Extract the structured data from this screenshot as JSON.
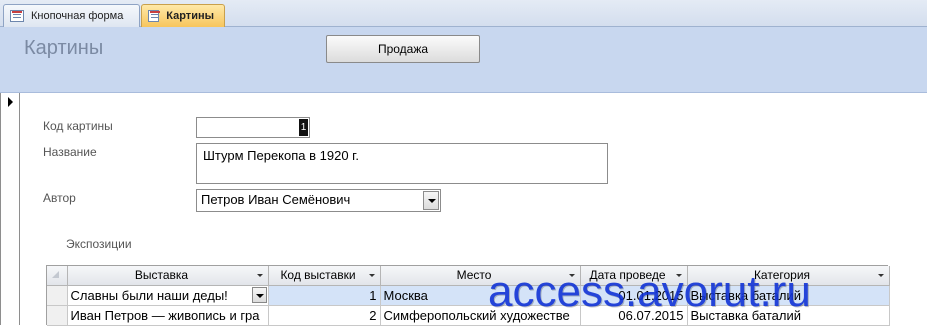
{
  "tabs": [
    {
      "label": "Кнопочная форма",
      "active": false
    },
    {
      "label": "Картины",
      "active": true
    }
  ],
  "header": {
    "title": "Картины",
    "sale_button": "Продажа"
  },
  "fields": {
    "code_label": "Код картины",
    "code_value": "1",
    "name_label": "Название",
    "name_value": "Штурм Перекопа в 1920 г.",
    "author_label": "Автор",
    "author_value": "Петров Иван Семёнович"
  },
  "subform": {
    "label": "Экспозиции",
    "columns": [
      "Выставка",
      "Код выставки",
      "Место",
      "Дата проведе",
      "Категория"
    ],
    "rows": [
      [
        "Славны были наши деды!",
        "1",
        "Москва",
        "01.01.2015",
        "Выставка баталий"
      ],
      [
        "Иван Петров — живопись и гра",
        "2",
        "Симферопольский художестве",
        "06.07.2015",
        "Выставка баталий"
      ]
    ]
  },
  "watermark": "access.avorut.ru",
  "colors": {
    "header_bg": "#c8d7ef",
    "active_tab": "#f7c55c",
    "selection": "#d4e3f8",
    "watermark": "#1133d6"
  }
}
